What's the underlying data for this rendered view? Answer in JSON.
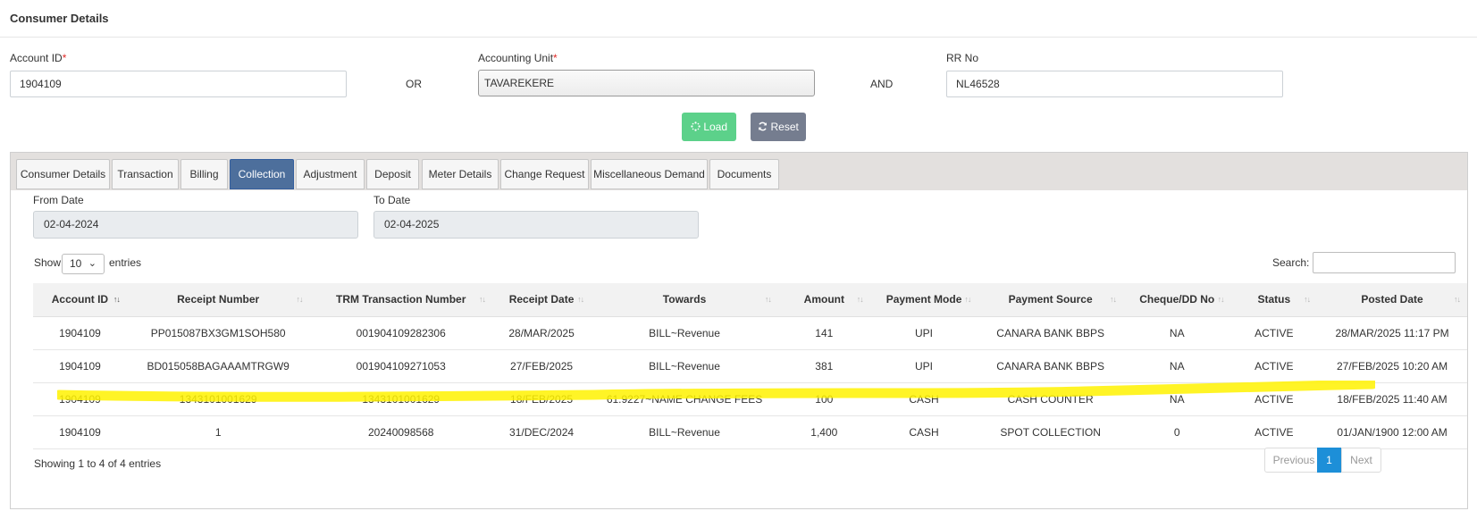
{
  "header": {
    "title": "Consumer Details"
  },
  "form": {
    "account_id": {
      "label": "Account ID",
      "required_mark": "*",
      "value": "1904109"
    },
    "or_label": "OR",
    "accounting_unit": {
      "label": "Accounting Unit",
      "required_mark": "*",
      "value": "TAVAREKERE"
    },
    "and_label": "AND",
    "rr_no": {
      "label": "RR No",
      "value": "NL46528"
    },
    "load_label": "Load",
    "reset_label": "Reset"
  },
  "tabs": [
    {
      "label": "Consumer Details"
    },
    {
      "label": "Transaction"
    },
    {
      "label": "Billing"
    },
    {
      "label": "Collection"
    },
    {
      "label": "Adjustment"
    },
    {
      "label": "Deposit"
    },
    {
      "label": "Meter Details"
    },
    {
      "label": "Change Request"
    },
    {
      "label": "Miscellaneous Demand"
    },
    {
      "label": "Documents"
    }
  ],
  "active_tab": "Collection",
  "filters": {
    "from_date": {
      "label": "From Date",
      "value": "02-04-2024"
    },
    "to_date": {
      "label": "To Date",
      "value": "02-04-2025"
    }
  },
  "table_controls": {
    "show_label": "Show",
    "page_length": "10",
    "entries_label": "entries",
    "search_label": "Search:"
  },
  "table": {
    "columns": [
      "Account ID",
      "Receipt Number",
      "TRM Transaction Number",
      "Receipt Date",
      "Towards",
      "Amount",
      "Payment Mode",
      "Payment Source",
      "Cheque/DD No",
      "Status",
      "Posted Date"
    ],
    "rows": [
      [
        "1904109",
        "PP015087BX3GM1SOH580",
        "001904109282306",
        "28/MAR/2025",
        "BILL~Revenue",
        "141",
        "UPI",
        "CANARA BANK BBPS",
        "NA",
        "ACTIVE",
        "28/MAR/2025 11:17 PM"
      ],
      [
        "1904109",
        "BD015058BAGAAAMTRGW9",
        "001904109271053",
        "27/FEB/2025",
        "BILL~Revenue",
        "381",
        "UPI",
        "CANARA BANK BBPS",
        "NA",
        "ACTIVE",
        "27/FEB/2025 10:20 AM"
      ],
      [
        "1904109",
        "1343101001629",
        "1343101001629",
        "18/FEB/2025",
        "61.9227~NAME CHANGE FEES",
        "100",
        "CASH",
        "CASH COUNTER",
        "NA",
        "ACTIVE",
        "18/FEB/2025 11:40 AM"
      ],
      [
        "1904109",
        "1",
        "20240098568",
        "31/DEC/2024",
        "BILL~Revenue",
        "1,400",
        "CASH",
        "SPOT COLLECTION",
        "0",
        "ACTIVE",
        "01/JAN/1900 12:00 AM"
      ]
    ]
  },
  "footer": {
    "info": "Showing 1 to 4 of 4 entries",
    "previous_label": "Previous",
    "current_page": "1",
    "next_label": "Next"
  },
  "colors": {
    "load_button": "#5cd18a",
    "reset_button": "#757d8f",
    "active_tab": "#4d6f9c",
    "current_page": "#1d8fd8",
    "highlighter": "#fff200"
  },
  "icons": {
    "load": "spinner-icon",
    "reset": "refresh-icon",
    "sort": "sort-arrows-icon",
    "dropdown": "chevron-down-icon"
  }
}
